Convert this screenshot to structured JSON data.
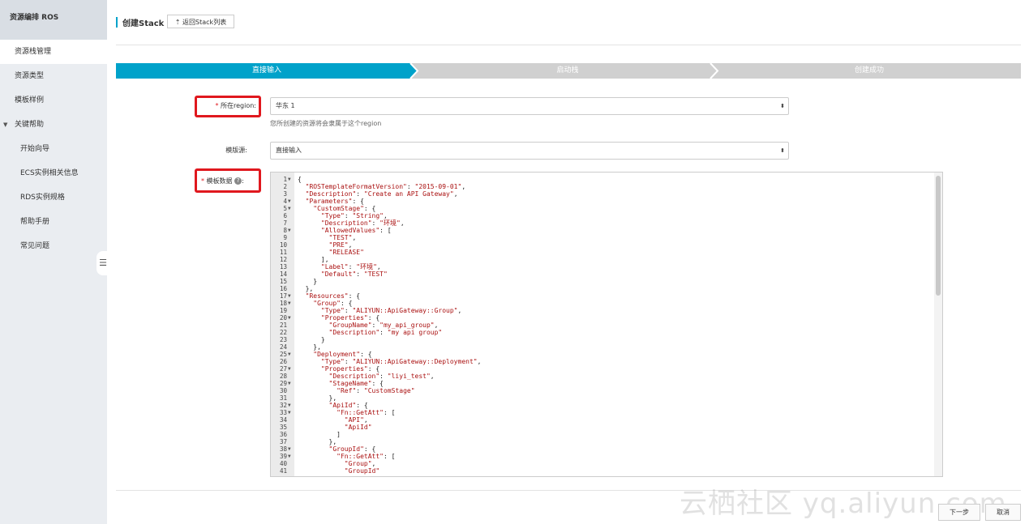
{
  "sidebar": {
    "title": "资源编排 ROS",
    "items": [
      {
        "label": "资源栈管理"
      },
      {
        "label": "资源类型"
      },
      {
        "label": "模板样例"
      },
      {
        "label": "关键帮助"
      },
      {
        "label": "开始向导"
      },
      {
        "label": "ECS实例相关信息"
      },
      {
        "label": "RDS实例规格"
      },
      {
        "label": "帮助手册"
      },
      {
        "label": "常见问题"
      }
    ]
  },
  "header": {
    "title": "创建Stack",
    "back_label": "返回Stack列表"
  },
  "steps": [
    {
      "label": "直接输入"
    },
    {
      "label": "启动栈"
    },
    {
      "label": "创建成功"
    }
  ],
  "form": {
    "region_label": "所在region:",
    "region_value": "华东 1",
    "region_hint": "您所创建的资源将会隶属于这个region",
    "source_label": "模版源:",
    "source_value": "直接输入",
    "data_label": "模板数据"
  },
  "editor": {
    "lines": [
      "{",
      "  \"ROSTemplateFormatVersion\": \"2015-09-01\",",
      "  \"Description\": \"Create an API Gateway\",",
      "  \"Parameters\": {",
      "    \"CustomStage\": {",
      "      \"Type\": \"String\",",
      "      \"Description\": \"环境\",",
      "      \"AllowedValues\": [",
      "        \"TEST\",",
      "        \"PRE\",",
      "        \"RELEASE\"",
      "      ],",
      "      \"Label\": \"环境\",",
      "      \"Default\": \"TEST\"",
      "    }",
      "  },",
      "  \"Resources\": {",
      "    \"Group\": {",
      "      \"Type\": \"ALIYUN::ApiGateway::Group\",",
      "      \"Properties\": {",
      "        \"GroupName\": \"my_api_group\",",
      "        \"Description\": \"my api group\"",
      "      }",
      "    },",
      "    \"Deployment\": {",
      "      \"Type\": \"ALIYUN::ApiGateway::Deployment\",",
      "      \"Properties\": {",
      "        \"Description\": \"liyi_test\",",
      "        \"StageName\": {",
      "          \"Ref\": \"CustomStage\"",
      "        },",
      "        \"ApiId\": {",
      "          \"Fn::GetAtt\": [",
      "            \"API\",",
      "            \"ApiId\"",
      "          ]",
      "        },",
      "        \"GroupId\": {",
      "          \"Fn::GetAtt\": [",
      "            \"Group\",",
      "            \"GroupId\""
    ],
    "fold_lines": [
      1,
      4,
      5,
      8,
      17,
      18,
      20,
      25,
      27,
      29,
      32,
      33,
      38,
      39
    ]
  },
  "footer": {
    "next_label": "下一步",
    "cancel_label": "取消"
  },
  "watermark": "云栖社区 yq.aliyun.com",
  "colors": {
    "accent": "#00a2ca",
    "step_inactive": "#d0d0d0",
    "highlight": "#e0181e"
  }
}
